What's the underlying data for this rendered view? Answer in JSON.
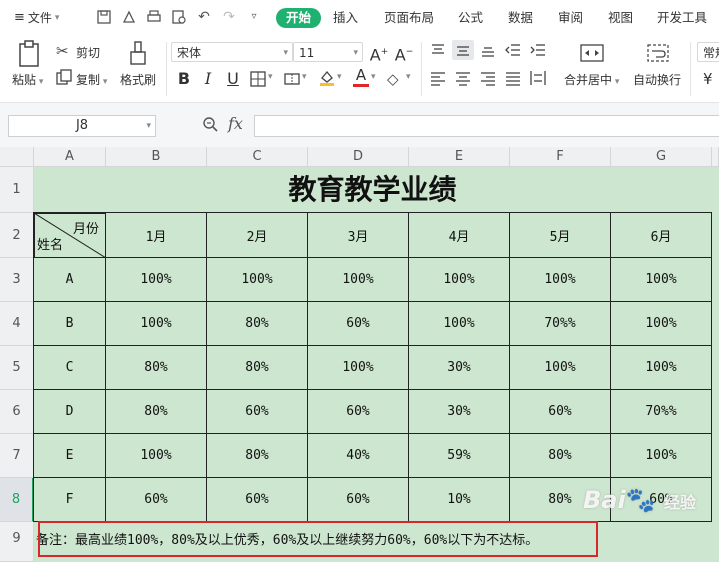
{
  "menu": {
    "file_label": "文件",
    "tabs": [
      {
        "label": "开始",
        "active": true
      },
      {
        "label": "插入"
      },
      {
        "label": "页面布局"
      },
      {
        "label": "公式"
      },
      {
        "label": "数据"
      },
      {
        "label": "审阅"
      },
      {
        "label": "视图"
      },
      {
        "label": "开发工具"
      }
    ]
  },
  "ribbon": {
    "paste": "粘贴",
    "cut": "剪切",
    "copy": "复制",
    "format_painter": "格式刷",
    "font_name": "宋体",
    "font_size": "11",
    "merge_center": "合并居中",
    "wrap_text": "自动换行",
    "number_format": "常规",
    "currency_symbol": "¥",
    "bold": "B",
    "italic": "I",
    "underline": "U"
  },
  "formula_bar": {
    "cell_ref": "J8",
    "fx_label": "fx"
  },
  "sheet": {
    "columns": [
      "A",
      "B",
      "C",
      "D",
      "E",
      "F",
      "G"
    ],
    "rows": [
      "1",
      "2",
      "3",
      "4",
      "5",
      "6",
      "7",
      "8",
      "9"
    ],
    "selected_row": "8",
    "title": "教育教学业绩",
    "header_month": "月份",
    "header_name": "姓名",
    "months": [
      "1月",
      "2月",
      "3月",
      "4月",
      "5月",
      "6月"
    ],
    "data": [
      {
        "name": "A",
        "values": [
          "100%",
          "100%",
          "100%",
          "100%",
          "100%",
          "100%"
        ]
      },
      {
        "name": "B",
        "values": [
          "100%",
          "80%",
          "60%",
          "100%",
          "70%%",
          "100%"
        ]
      },
      {
        "name": "C",
        "values": [
          "80%",
          "80%",
          "100%",
          "30%",
          "100%",
          "100%"
        ]
      },
      {
        "name": "D",
        "values": [
          "80%",
          "60%",
          "60%",
          "30%",
          "60%",
          "70%%"
        ]
      },
      {
        "name": "E",
        "values": [
          "100%",
          "80%",
          "40%",
          "59%",
          "80%",
          "100%"
        ]
      },
      {
        "name": "F",
        "values": [
          "60%",
          "60%",
          "60%",
          "10%",
          "80%",
          "60%"
        ]
      }
    ],
    "note": "备注：最高业绩100%，80%及以上优秀，60%及以上继续努力60%，60%以下为不达标。"
  },
  "watermark": {
    "text": "Bai",
    "suffix": "经验"
  },
  "colors": {
    "accent": "#1fb170",
    "sheet_fill": "#cde6cf",
    "highlight_box": "#d9262a"
  }
}
